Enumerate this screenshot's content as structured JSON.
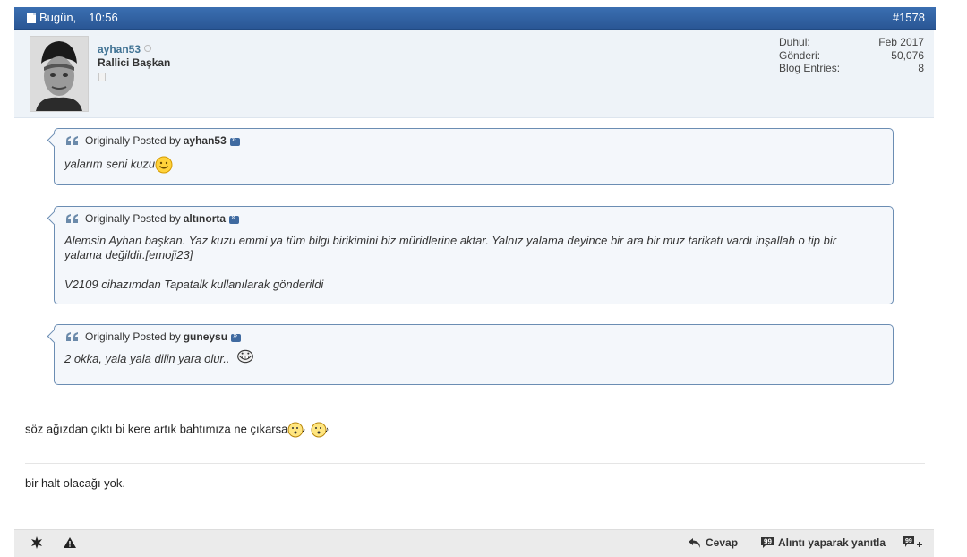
{
  "header": {
    "date_label": "Bugün,",
    "time": "10:56",
    "post_number": "#1578"
  },
  "user": {
    "name": "ayhan53",
    "title": "Rallici Başkan",
    "stats": [
      {
        "label": "Duhul:",
        "value": "Feb 2017"
      },
      {
        "label": "Gönderi:",
        "value": "50,076"
      },
      {
        "label": "Blog Entries:",
        "value": "8"
      }
    ]
  },
  "quotes": [
    {
      "prefix": "Originally Posted by",
      "author": "ayhan53",
      "lines": [
        "yalarım seni kuzu"
      ],
      "smiley": "smile-icon"
    },
    {
      "prefix": "Originally Posted by",
      "author": "altınorta",
      "lines": [
        "Alemsin Ayhan başkan. Yaz kuzu emmi ya tüm bilgi birikimini biz müridlerine aktar. Yalnız yalama deyince bir ara bir muz tarikatı vardı inşallah o tip bir",
        "yalama değildir.[emoji23]",
        "",
        "V2109 cihazımdan Tapatalk kullanılarak gönderildi"
      ]
    },
    {
      "prefix": "Originally Posted by",
      "author": "guneysu",
      "lines": [
        "2 okka, yala yala dilin yara olur.."
      ],
      "smiley": "grin-icon"
    }
  ],
  "message": {
    "line1": "söz ağızdan çıktı bi kere artık bahtımıza ne çıkarsa",
    "line2": "bir halt olacağı yok."
  },
  "footer": {
    "reply_label": "Cevap",
    "quote_reply_label": "Alıntı yaparak yanıtla"
  },
  "colors": {
    "header_bg": "#2f5f9e",
    "username": "#417394",
    "quote_border": "#6b8db3",
    "quote_bg": "#f4f7fb"
  }
}
